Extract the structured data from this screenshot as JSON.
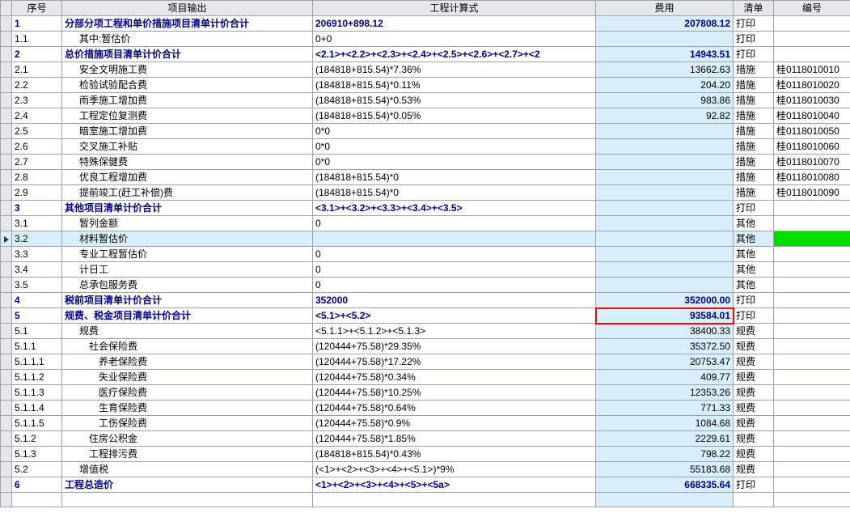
{
  "headers": {
    "seq": "序号",
    "out": "项目输出",
    "expr": "工程计算式",
    "fee": "费用",
    "bill": "清单",
    "code": "编号"
  },
  "rows": [
    {
      "g": "",
      "seq": "1",
      "out": "分部分项工程和单价措施项目清单计价合计",
      "expr": "206910+898.12",
      "fee": "207808.12",
      "bill": "打印",
      "code": "",
      "bold": true,
      "ind": 0
    },
    {
      "g": "",
      "seq": "1.1",
      "out": "其中:暂估价",
      "expr": "0+0",
      "fee": "",
      "bill": "打印",
      "code": "",
      "ind": 1
    },
    {
      "g": "",
      "seq": "2",
      "out": "总价措施项目清单计价合计",
      "expr": "<2.1>+<2.2>+<2.3>+<2.4>+<2.5>+<2.6>+<2.7>+<2",
      "fee": "14943.51",
      "bill": "打印",
      "code": "",
      "bold": true,
      "ind": 0
    },
    {
      "g": "",
      "seq": "2.1",
      "out": "安全文明施工费",
      "expr": "(184818+815.54)*7.36%",
      "fee": "13662.63",
      "bill": "措施",
      "code": "桂0118010010",
      "ind": 1
    },
    {
      "g": "",
      "seq": "2.2",
      "out": "检验试验配合费",
      "expr": "(184818+815.54)*0.11%",
      "fee": "204.20",
      "bill": "措施",
      "code": "桂0118010020",
      "ind": 1
    },
    {
      "g": "",
      "seq": "2.3",
      "out": "雨季施工增加费",
      "expr": "(184818+815.54)*0.53%",
      "fee": "983.86",
      "bill": "措施",
      "code": "桂0118010030",
      "ind": 1
    },
    {
      "g": "",
      "seq": "2.4",
      "out": "工程定位复测费",
      "expr": "(184818+815.54)*0.05%",
      "fee": "92.82",
      "bill": "措施",
      "code": "桂0118010040",
      "ind": 1
    },
    {
      "g": "",
      "seq": "2.5",
      "out": "暗室施工增加费",
      "expr": "0*0",
      "fee": "",
      "bill": "措施",
      "code": "桂0118010050",
      "ind": 1
    },
    {
      "g": "",
      "seq": "2.6",
      "out": "交叉施工补贴",
      "expr": "0*0",
      "fee": "",
      "bill": "措施",
      "code": "桂0118010060",
      "ind": 1
    },
    {
      "g": "",
      "seq": "2.7",
      "out": "特殊保健费",
      "expr": "0*0",
      "fee": "",
      "bill": "措施",
      "code": "桂0118010070",
      "ind": 1
    },
    {
      "g": "",
      "seq": "2.8",
      "out": "优良工程增加费",
      "expr": "(184818+815.54)*0",
      "fee": "",
      "bill": "措施",
      "code": "桂0118010080",
      "ind": 1
    },
    {
      "g": "",
      "seq": "2.9",
      "out": "提前竣工(赶工补偿)费",
      "expr": "(184818+815.54)*0",
      "fee": "",
      "bill": "措施",
      "code": "桂0118010090",
      "ind": 1
    },
    {
      "g": "",
      "seq": "3",
      "out": "其他项目清单计价合计",
      "expr": "<3.1>+<3.2>+<3.3>+<3.4>+<3.5>",
      "fee": "",
      "bill": "打印",
      "code": "",
      "bold": true,
      "ind": 0
    },
    {
      "g": "",
      "seq": "3.1",
      "out": "暂列金额",
      "expr": "0",
      "fee": "",
      "bill": "其他",
      "code": "",
      "ind": 1
    },
    {
      "g": "arrow",
      "seq": "3.2",
      "out": "材料暂估价",
      "expr": "",
      "fee": "",
      "bill": "其他",
      "code": "",
      "ind": 1,
      "selected": true
    },
    {
      "g": "",
      "seq": "3.3",
      "out": "专业工程暂估价",
      "expr": "0",
      "fee": "",
      "bill": "其他",
      "code": "",
      "ind": 1
    },
    {
      "g": "",
      "seq": "3.4",
      "out": "计日工",
      "expr": "0",
      "fee": "",
      "bill": "其他",
      "code": "",
      "ind": 1
    },
    {
      "g": "",
      "seq": "3.5",
      "out": "总承包服务费",
      "expr": "0",
      "fee": "",
      "bill": "其他",
      "code": "",
      "ind": 1
    },
    {
      "g": "",
      "seq": "4",
      "out": "税前项目清单计价合计",
      "expr": "352000",
      "fee": "352000.00",
      "bill": "打印",
      "code": "",
      "bold": true,
      "ind": 0
    },
    {
      "g": "",
      "seq": "5",
      "out": "规费、税金项目清单计价合计",
      "expr": "<5.1>+<5.2>",
      "fee": "93584.01",
      "bill": "打印",
      "code": "",
      "bold": true,
      "ind": 0,
      "redfee": true
    },
    {
      "g": "",
      "seq": "5.1",
      "out": "规费",
      "expr": "<5.1.1>+<5.1.2>+<5.1.3>",
      "fee": "38400.33",
      "bill": "规费",
      "code": "",
      "ind": 1
    },
    {
      "g": "",
      "seq": "5.1.1",
      "out": "社会保险费",
      "expr": "(120444+75.58)*29.35%",
      "fee": "35372.50",
      "bill": "规费",
      "code": "",
      "ind": 2
    },
    {
      "g": "",
      "seq": "5.1.1.1",
      "out": "养老保险费",
      "expr": "(120444+75.58)*17.22%",
      "fee": "20753.47",
      "bill": "规费",
      "code": "",
      "ind": 3
    },
    {
      "g": "",
      "seq": "5.1.1.2",
      "out": "失业保险费",
      "expr": "(120444+75.58)*0.34%",
      "fee": "409.77",
      "bill": "规费",
      "code": "",
      "ind": 3
    },
    {
      "g": "",
      "seq": "5.1.1.3",
      "out": "医疗保险费",
      "expr": "(120444+75.58)*10.25%",
      "fee": "12353.26",
      "bill": "规费",
      "code": "",
      "ind": 3
    },
    {
      "g": "",
      "seq": "5.1.1.4",
      "out": "生育保险费",
      "expr": "(120444+75.58)*0.64%",
      "fee": "771.33",
      "bill": "规费",
      "code": "",
      "ind": 3
    },
    {
      "g": "",
      "seq": "5.1.1.5",
      "out": "工伤保险费",
      "expr": "(120444+75.58)*0.9%",
      "fee": "1084.68",
      "bill": "规费",
      "code": "",
      "ind": 3
    },
    {
      "g": "",
      "seq": "5.1.2",
      "out": "住房公积金",
      "expr": "(120444+75.58)*1.85%",
      "fee": "2229.61",
      "bill": "规费",
      "code": "",
      "ind": 2
    },
    {
      "g": "",
      "seq": "5.1.3",
      "out": "工程排污费",
      "expr": "(184818+815.54)*0.43%",
      "fee": "798.22",
      "bill": "规费",
      "code": "",
      "ind": 2
    },
    {
      "g": "",
      "seq": "5.2",
      "out": "增值税",
      "expr": "(<1>+<2>+<3>+<4>+<5.1>)*9%",
      "fee": "55183.68",
      "bill": "规费",
      "code": "",
      "ind": 1
    },
    {
      "g": "",
      "seq": "6",
      "out": "工程总造价",
      "expr": "<1>+<2>+<3>+<4>+<5>+<5a>",
      "fee": "668335.64",
      "bill": "打印",
      "code": "",
      "bold": true,
      "ind": 0
    }
  ]
}
